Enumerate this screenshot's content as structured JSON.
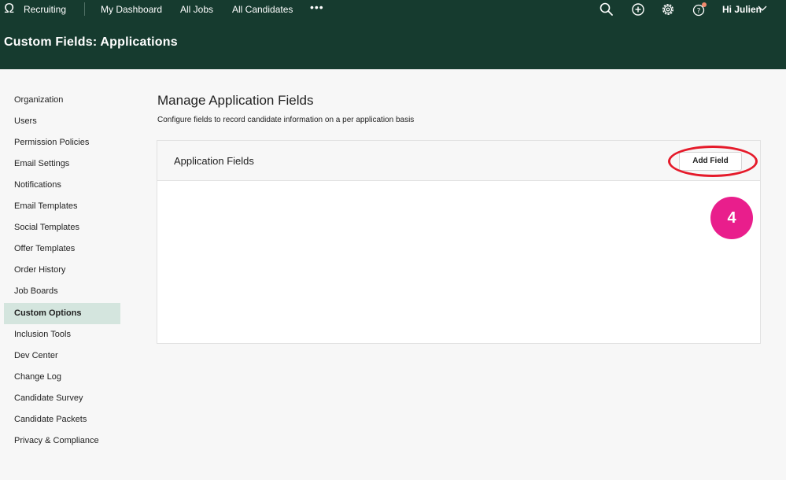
{
  "topnav": {
    "app_name": "Recruiting",
    "links": [
      "My Dashboard",
      "All Jobs",
      "All Candidates"
    ],
    "more": "•••",
    "greeting": "Hi Julien",
    "icons": [
      "search-icon",
      "add-icon",
      "settings-icon",
      "help-icon",
      "chevron-down-icon"
    ]
  },
  "page": {
    "header": "Custom Fields: Applications"
  },
  "sidebar": {
    "items": [
      "Organization",
      "Users",
      "Permission Policies",
      "Email Settings",
      "Notifications",
      "Email Templates",
      "Social Templates",
      "Offer Templates",
      "Order History",
      "Job Boards",
      "Custom Options",
      "Inclusion Tools",
      "Dev Center",
      "Change Log",
      "Candidate Survey",
      "Candidate Packets",
      "Privacy & Compliance"
    ],
    "active": "Custom Options"
  },
  "main": {
    "title": "Manage Application Fields",
    "subtitle": "Configure fields to record candidate information on a per application basis",
    "card": {
      "title": "Application Fields",
      "add_button": "Add Field"
    }
  },
  "annotation": {
    "step": "4",
    "ring_color": "#e51a2a",
    "badge_color": "#e91e8c"
  },
  "colors": {
    "header_bg": "#163b2f",
    "active_item_bg": "#d4e5de"
  }
}
